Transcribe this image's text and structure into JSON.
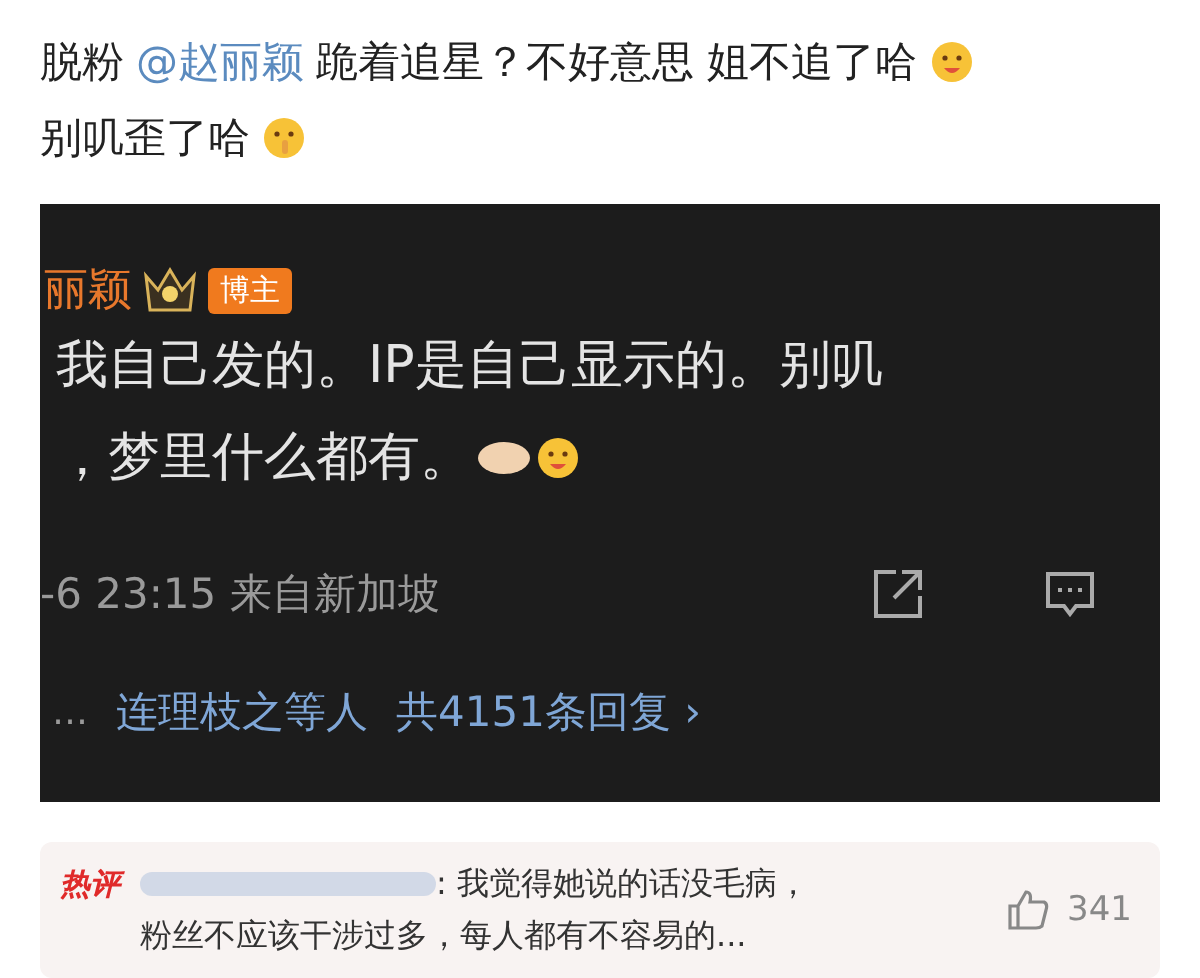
{
  "post": {
    "text_before": "脱粉",
    "mention": "@赵丽颖",
    "text_after": "跪着追星？不好意思 姐不追了哈",
    "line2": "别叽歪了哈"
  },
  "embedded_screenshot": {
    "author": "丽颖",
    "badge": "博主",
    "lines": [
      "我自己发的。IP是自己显示的。别叽",
      "，梦里什么都有。"
    ],
    "meta": "-6 23:15 来自新加坡",
    "ellipsis": "…",
    "replier": "连理枝之等人",
    "reply_count": "共4151条回复",
    "chevron": "›"
  },
  "hot_comment": {
    "tag": "热评",
    "lines": [
      ": 我觉得她说的话没毛病，",
      "粉丝不应该干涉过多，每人都有不容易的..."
    ],
    "likes": "341"
  }
}
